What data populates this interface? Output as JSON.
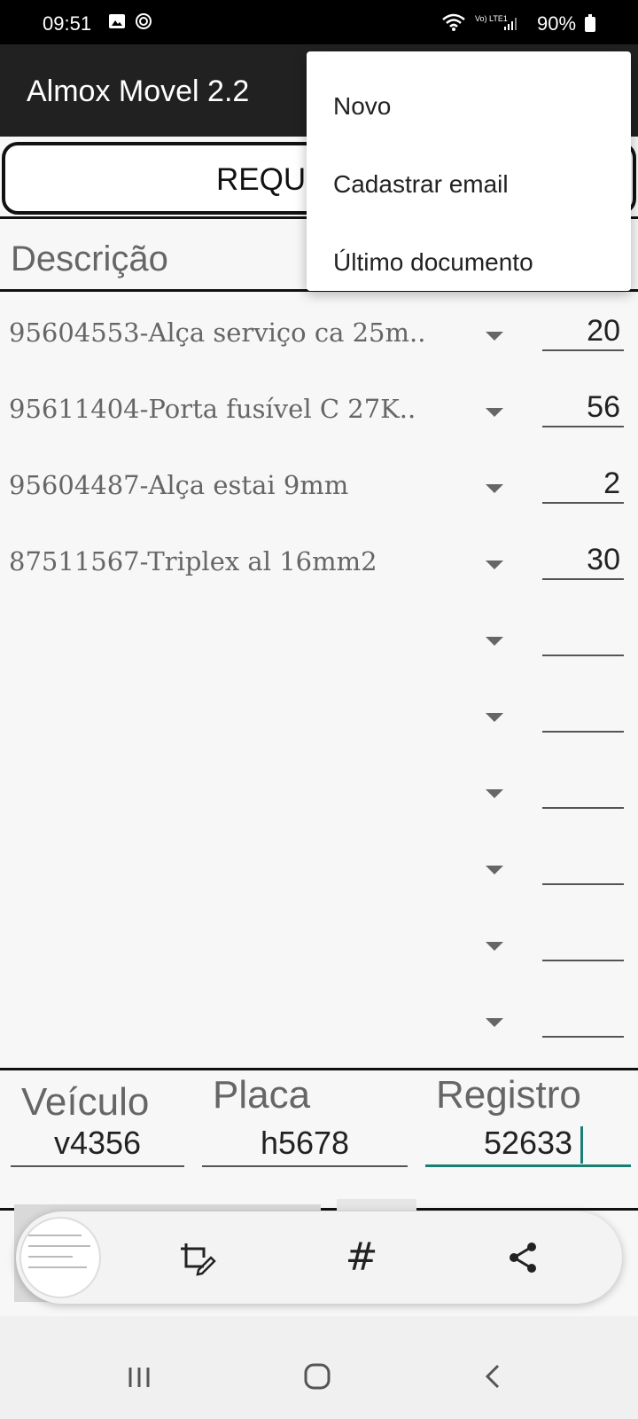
{
  "status_bar": {
    "time": "09:51",
    "network_label": "Vo) LTE1",
    "battery": "90%"
  },
  "app_bar": {
    "title": "Almox Movel 2.2"
  },
  "requisition_button": {
    "label": "REQU"
  },
  "list_header": {
    "description": "Descrição"
  },
  "items": [
    {
      "description": "95604553-Alça serviço ca 25m..",
      "quantity": "20"
    },
    {
      "description": "95611404-Porta fusível C 27K..",
      "quantity": "56"
    },
    {
      "description": "95604487-Alça estai 9mm",
      "quantity": "2"
    },
    {
      "description": "87511567-Triplex al 16mm2",
      "quantity": "30"
    },
    {
      "description": "",
      "quantity": ""
    },
    {
      "description": "",
      "quantity": ""
    },
    {
      "description": "",
      "quantity": ""
    },
    {
      "description": "",
      "quantity": ""
    },
    {
      "description": "",
      "quantity": ""
    },
    {
      "description": "",
      "quantity": ""
    }
  ],
  "fields": {
    "vehicle": {
      "label": "Veículo",
      "value": "v4356"
    },
    "plate": {
      "label": "Placa",
      "value": "h5678"
    },
    "registration": {
      "label": "Registro",
      "value": "52633"
    }
  },
  "menu": {
    "items": [
      {
        "label": "Novo"
      },
      {
        "label": "Cadastrar email"
      },
      {
        "label": "Último documento"
      }
    ]
  },
  "screenshot_toolbar": {
    "hash_symbol": "#"
  },
  "colors": {
    "app_bar": "#212121",
    "accent": "#1a7f73",
    "status_bar": "#000000"
  },
  "icons": [
    "image-icon",
    "settings-circle-icon",
    "wifi-icon",
    "signal-icon",
    "battery-icon",
    "dropdown-arrow-icon",
    "crop-edit-icon",
    "hash-icon",
    "share-icon",
    "recents-icon",
    "home-icon",
    "back-icon"
  ]
}
